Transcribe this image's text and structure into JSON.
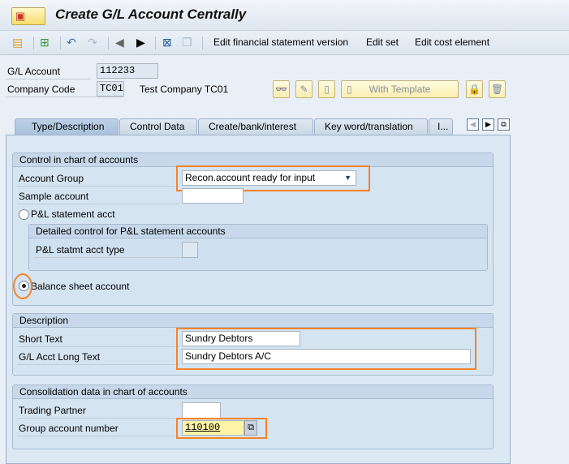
{
  "title": "Create G/L Account Centrally",
  "toolbar": {
    "items": [
      "Edit financial statement version",
      "Edit set",
      "Edit cost element"
    ]
  },
  "header": {
    "gl_account_label": "G/L Account",
    "gl_account_value": "112233",
    "company_code_label": "Company Code",
    "company_code_value": "TC01",
    "company_name": "Test Company TC01",
    "with_template": "With Template"
  },
  "tabs": [
    "Type/Description",
    "Control Data",
    "Create/bank/interest",
    "Key word/translation",
    "I..."
  ],
  "control": {
    "title": "Control in chart of accounts",
    "account_group_label": "Account Group",
    "account_group_value": "Recon.account ready for input",
    "sample_account_label": "Sample account",
    "pl_label": "P&L statement acct",
    "detailed_title": "Detailed control for P&L statement accounts",
    "pl_type_label": "P&L statmt acct type",
    "balance_label": "Balance sheet account",
    "selected": "Balance sheet account"
  },
  "description": {
    "title": "Description",
    "short_text_label": "Short Text",
    "short_text_value": "Sundry Debtors",
    "long_text_label": "G/L Acct Long Text",
    "long_text_value": "Sundry Debtors A/C"
  },
  "consolidation": {
    "title": "Consolidation data in chart of accounts",
    "trading_partner_label": "Trading Partner",
    "group_account_label": "Group account number",
    "group_account_value": "110100"
  },
  "colors": {
    "highlight": "#f5842a",
    "field_focus": "#fff3a6"
  }
}
